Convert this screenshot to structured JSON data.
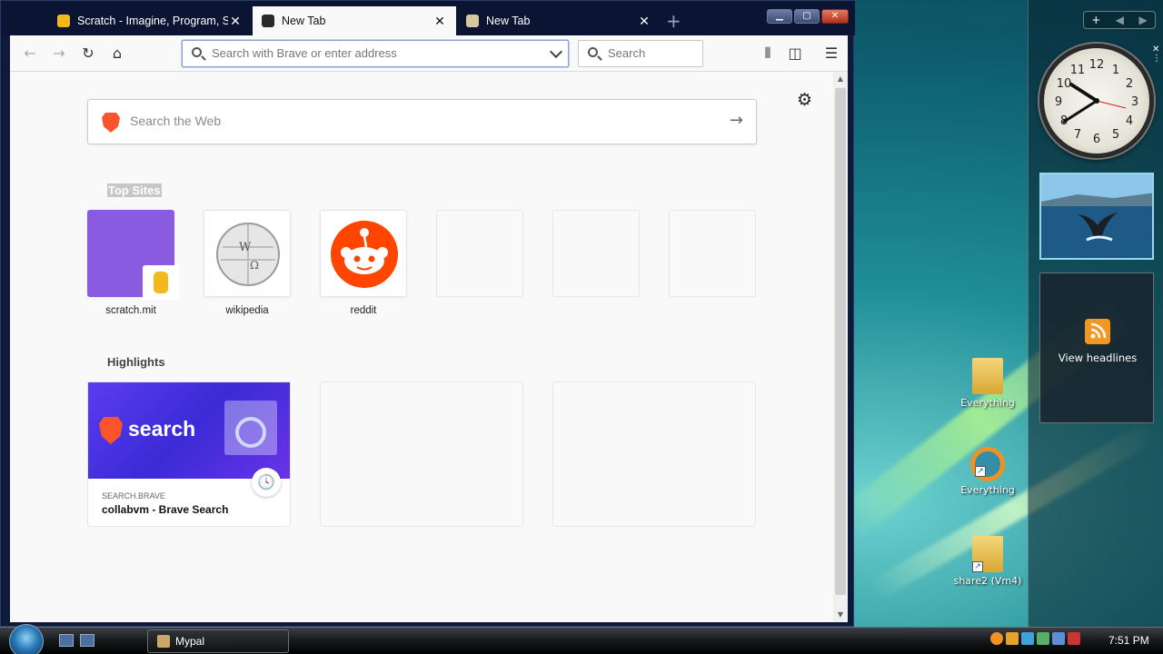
{
  "browser": {
    "tabs": [
      {
        "title": "Scratch - Imagine, Program, Share",
        "active": false,
        "favicon": "scratch-favicon"
      },
      {
        "title": "New Tab",
        "active": true,
        "favicon": "brave-lion-favicon"
      },
      {
        "title": "New Tab",
        "active": false,
        "favicon": "brave-lion-favicon"
      }
    ],
    "urlbar_placeholder": "Search with Brave or enter address",
    "searchbar_placeholder": "Search",
    "newtab": {
      "web_search_placeholder": "Search the Web",
      "top_sites_heading": "Top Sites",
      "top_sites": [
        {
          "label": "scratch.mit",
          "icon": "scratch-icon"
        },
        {
          "label": "wikipedia",
          "icon": "wikipedia-globe-icon"
        },
        {
          "label": "reddit",
          "icon": "reddit-icon"
        },
        {
          "label": ""
        },
        {
          "label": ""
        },
        {
          "label": ""
        }
      ],
      "highlights_heading": "Highlights",
      "highlights": [
        {
          "image_text": "search",
          "host": "SEARCH.BRAVE",
          "title": "collabvm - Brave Search"
        }
      ]
    }
  },
  "desktop": {
    "sidebar_feed_label": "View headlines",
    "icons": [
      {
        "label": "Everything",
        "type": "folder"
      },
      {
        "label": "Everything",
        "type": "app-shortcut"
      },
      {
        "label": "share2 (Vm4)",
        "type": "folder-shortcut"
      }
    ]
  },
  "taskbar": {
    "task_button": "Mypal",
    "clock": "7:51 PM"
  },
  "colors": {
    "tab_strip": "#0b1433",
    "brave_orange": "#fb542b",
    "reddit_orange": "#ff4500",
    "scratch_purple": "#8a5be0"
  }
}
